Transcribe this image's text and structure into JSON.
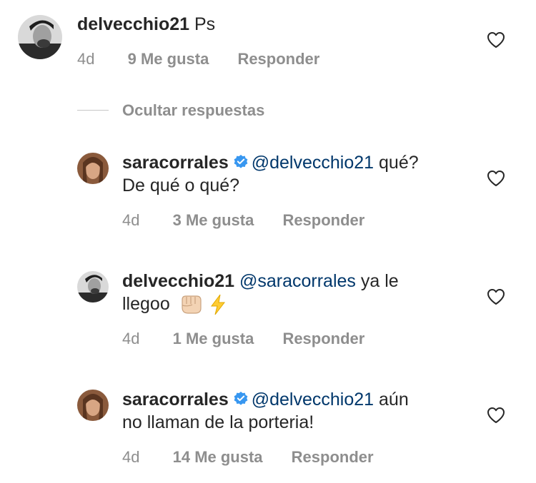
{
  "comments": [
    {
      "username": "delvecchio21",
      "verified": false,
      "mention": "",
      "body": "Ps",
      "time": "4d",
      "likes": "9 Me gusta",
      "reply": "Responder"
    },
    {
      "username": "saracorrales",
      "verified": true,
      "mention": "@delvecchio21",
      "body": "qué?",
      "body2": "De qué o qué?",
      "time": "4d",
      "likes": "3 Me gusta",
      "reply": "Responder"
    },
    {
      "username": "delvecchio21",
      "verified": false,
      "mention": "@saracorrales",
      "body": "ya le",
      "body2": "llegoo",
      "emojis": [
        "oncoming-fist-icon",
        "lightning-icon"
      ],
      "time": "4d",
      "likes": "1 Me gusta",
      "reply": "Responder"
    },
    {
      "username": "saracorrales",
      "verified": true,
      "mention": "@delvecchio21",
      "body": "aún",
      "body2": "no llaman de la porteria!",
      "time": "4d",
      "likes": "14 Me gusta",
      "reply": "Responder"
    }
  ],
  "thread": {
    "hide_replies": "Ocultar respuestas"
  },
  "colors": {
    "text": "#262626",
    "secondary": "#8e8e8e",
    "mention": "#00376b",
    "verified": "#3897f0"
  }
}
